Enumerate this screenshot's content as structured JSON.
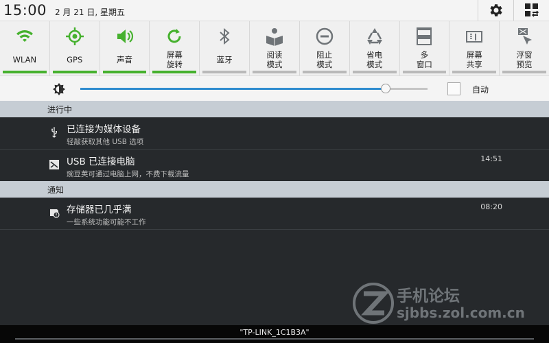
{
  "status": {
    "time": "15:00",
    "date": "2 月 21 日, 星期五"
  },
  "toggles": [
    {
      "label": "WLAN",
      "icon": "wifi-icon",
      "on": true
    },
    {
      "label": "GPS",
      "icon": "gps-icon",
      "on": true
    },
    {
      "label": "声音",
      "icon": "sound-icon",
      "on": true
    },
    {
      "label": "屏幕\n旋转",
      "icon": "rotate-icon",
      "on": true
    },
    {
      "label": "蓝牙",
      "icon": "bluetooth-icon",
      "on": false
    },
    {
      "label": "阅读\n模式",
      "icon": "reading-icon",
      "on": false
    },
    {
      "label": "阻止\n模式",
      "icon": "block-icon",
      "on": false
    },
    {
      "label": "省电\n模式",
      "icon": "power-saving-icon",
      "on": false
    },
    {
      "label": "多\n窗口",
      "icon": "multi-window-icon",
      "on": false
    },
    {
      "label": "屏幕\n共享",
      "icon": "screen-mirror-icon",
      "on": false
    },
    {
      "label": "浮窗\n预览",
      "icon": "float-window-icon",
      "on": false
    }
  ],
  "brightness": {
    "level": 0.88,
    "auto_label": "自动",
    "auto_checked": false
  },
  "sections": {
    "ongoing": "进行中",
    "notifications": "通知"
  },
  "ongoing_items": [
    {
      "title": "已连接为媒体设备",
      "subtitle": "轻敲获取其他 USB 选项",
      "time": "",
      "icon": "usb-icon"
    },
    {
      "title": "USB 已连接电脑",
      "subtitle": "豌豆荚可通过电脑上网，不费下载流量",
      "time": "14:51",
      "icon": "wandoujia-icon"
    }
  ],
  "notification_items": [
    {
      "title": "存储器已几乎满",
      "subtitle": "一些系统功能可能不工作",
      "time": "08:20",
      "icon": "storage-warning-icon"
    }
  ],
  "watermark": {
    "line1": "手机论坛",
    "line2": "sjbbs.zol.com.cn"
  },
  "network": {
    "name": "\"TP-LINK_1C1B3A\""
  },
  "colors": {
    "toggle_on": "#46b12e",
    "toggle_off": "#b9b9b9",
    "slider": "#2f8ccf",
    "section_header": "#c6cdd4",
    "notification_bg": "#26292c"
  }
}
